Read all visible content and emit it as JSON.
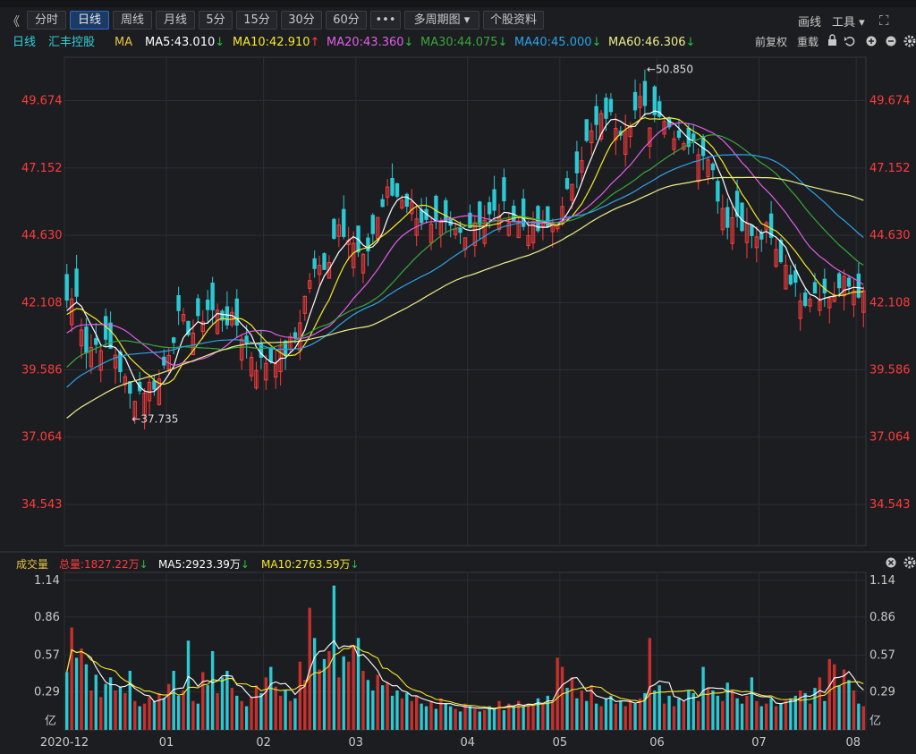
{
  "toolbar": {
    "collapse_icon": "double-chevron-left-icon",
    "collapse_glyph": "《",
    "buttons": [
      "分时",
      "日线",
      "周线",
      "月线",
      "5分",
      "15分",
      "30分",
      "60分",
      "•••",
      "多周期图 ▾",
      "个股资料"
    ],
    "active_index": 1,
    "draw_label": "画线",
    "tools_label": "工具 ▾",
    "fullscreen_icon": "fullscreen-icon",
    "fullscreen_glyph": "⛶"
  },
  "ma_legend": {
    "period": "日线",
    "stock_name": "汇丰控股",
    "indicator": "MA",
    "items": [
      {
        "text": "MA5:43.010",
        "arrow": "↓",
        "color": "#ffffff",
        "arrow_color": "#27c03c"
      },
      {
        "text": "MA10:42.910",
        "arrow": "↑",
        "color": "#f5e82a",
        "arrow_color": "#ff3b3b"
      },
      {
        "text": "MA20:43.360",
        "arrow": "↓",
        "color": "#e15fe6",
        "arrow_color": "#27c03c"
      },
      {
        "text": "MA30:44.075",
        "arrow": "↓",
        "color": "#3aa53a",
        "arrow_color": "#27c03c"
      },
      {
        "text": "MA40:45.000",
        "arrow": "↓",
        "color": "#2ba3e8",
        "arrow_color": "#27c03c"
      },
      {
        "text": "MA60:46.306",
        "arrow": "↓",
        "color": "#eded8a",
        "arrow_color": "#27c03c"
      }
    ],
    "adjust_label": "前复权",
    "reload_label": "重载",
    "lock_icon": "lock-icon",
    "undo_icon": "undo-icon",
    "zoom_in_icon": "zoom-in-icon",
    "zoom_out_icon": "zoom-out-icon",
    "settings_icon": "gear-icon"
  },
  "vol_legend": {
    "title": "成交量",
    "total": "总量:1827.22万",
    "total_arrow": "↓",
    "ma5": "MA5:2923.39万",
    "ma5_arrow": "↓",
    "ma10": "MA10:2763.59万",
    "ma10_arrow": "↓",
    "close_icon": "close-circle-icon",
    "settings_icon": "gear-icon"
  },
  "colors": {
    "up": "#ff3b3b",
    "down": "#2bc9d4",
    "grid": "#2c2e34",
    "axis_text": "#ff3b3b",
    "date_text": "#c8c8c8"
  },
  "chart_data": {
    "type": "candlestick",
    "price_ticks": [
      49.674,
      47.152,
      44.63,
      42.108,
      39.586,
      37.064,
      34.543
    ],
    "price_range": [
      33.0,
      51.3
    ],
    "x_labels": [
      "2020-12",
      "01",
      "02",
      "03",
      "04",
      "05",
      "06",
      "07",
      "08"
    ],
    "x_label_index": [
      0,
      21,
      41,
      60,
      83,
      102,
      122,
      143,
      163
    ],
    "annotations": [
      {
        "text": "←50.850",
        "index": 119,
        "price": 50.85
      },
      {
        "text": "←37.735",
        "index": 13,
        "price": 37.735
      }
    ],
    "anchors": [
      [
        0,
        42.2
      ],
      [
        2,
        42.3
      ],
      [
        4,
        40.4
      ],
      [
        7,
        40.6
      ],
      [
        10,
        40.2
      ],
      [
        13,
        38.6
      ],
      [
        16,
        38.9
      ],
      [
        19,
        39.2
      ],
      [
        23,
        41.5
      ],
      [
        26,
        41.0
      ],
      [
        29,
        41.9
      ],
      [
        32,
        41.6
      ],
      [
        35,
        41.3
      ],
      [
        39,
        39.8
      ],
      [
        42,
        40.0
      ],
      [
        45,
        40.3
      ],
      [
        47,
        40.8
      ],
      [
        50,
        43.0
      ],
      [
        54,
        43.8
      ],
      [
        56,
        45.3
      ],
      [
        58,
        44.5
      ],
      [
        61,
        43.6
      ],
      [
        64,
        45.3
      ],
      [
        66,
        46.2
      ],
      [
        69,
        46.1
      ],
      [
        72,
        45.5
      ],
      [
        75,
        44.8
      ],
      [
        78,
        44.9
      ],
      [
        81,
        44.7
      ],
      [
        84,
        45.2
      ],
      [
        87,
        45.3
      ],
      [
        90,
        45.6
      ],
      [
        93,
        45.1
      ],
      [
        96,
        44.8
      ],
      [
        99,
        44.9
      ],
      [
        102,
        45.5
      ],
      [
        105,
        47.3
      ],
      [
        108,
        48.4
      ],
      [
        111,
        49.2
      ],
      [
        114,
        48.7
      ],
      [
        116,
        49.0
      ],
      [
        118,
        49.6
      ],
      [
        120,
        48.9
      ],
      [
        122,
        49.4
      ],
      [
        124,
        48.7
      ],
      [
        126,
        48.4
      ],
      [
        128,
        48.1
      ],
      [
        130,
        47.9
      ],
      [
        132,
        47.8
      ],
      [
        134,
        46.2
      ],
      [
        136,
        45.2
      ],
      [
        138,
        45.4
      ],
      [
        140,
        44.9
      ],
      [
        142,
        44.4
      ],
      [
        144,
        44.8
      ],
      [
        146,
        44.0
      ],
      [
        148,
        43.6
      ],
      [
        150,
        42.6
      ],
      [
        152,
        42.3
      ],
      [
        154,
        42.6
      ],
      [
        157,
        42.3
      ],
      [
        160,
        42.8
      ],
      [
        162,
        42.6
      ],
      [
        164,
        42.55
      ]
    ],
    "volume_ticks": [
      1.14,
      0.86,
      0.57,
      0.29
    ],
    "volume_unit": "亿",
    "volume_range": [
      0,
      1.2
    ],
    "volume_series": [
      0.44,
      0.78,
      0.55,
      0.62,
      0.5,
      0.3,
      0.42,
      0.25,
      0.35,
      0.4,
      0.3,
      0.33,
      0.28,
      0.45,
      0.22,
      0.18,
      0.2,
      0.25,
      0.22,
      0.28,
      0.24,
      0.35,
      0.45,
      0.26,
      0.3,
      0.68,
      0.22,
      0.2,
      0.44,
      0.34,
      0.6,
      0.28,
      0.4,
      0.45,
      0.32,
      0.26,
      0.22,
      0.18,
      0.25,
      0.34,
      0.28,
      0.4,
      0.48,
      0.33,
      0.26,
      0.3,
      0.22,
      0.24,
      0.52,
      0.38,
      0.93,
      0.7,
      0.46,
      0.54,
      0.6,
      1.1,
      0.4,
      0.56,
      0.52,
      0.64,
      0.7,
      0.45,
      0.38,
      0.3,
      0.42,
      0.34,
      0.36,
      0.26,
      0.3,
      0.24,
      0.28,
      0.22,
      0.26,
      0.2,
      0.18,
      0.22,
      0.16,
      0.24,
      0.2,
      0.18,
      0.16,
      0.14,
      0.2,
      0.18,
      0.16,
      0.14,
      0.15,
      0.18,
      0.16,
      0.22,
      0.15,
      0.2,
      0.18,
      0.22,
      0.18,
      0.2,
      0.19,
      0.24,
      0.2,
      0.26,
      0.22,
      0.55,
      0.48,
      0.32,
      0.4,
      0.24,
      0.3,
      0.22,
      0.34,
      0.2,
      0.18,
      0.24,
      0.26,
      0.2,
      0.22,
      0.18,
      0.22,
      0.2,
      0.24,
      0.28,
      0.7,
      0.3,
      0.34,
      0.2,
      0.26,
      0.18,
      0.24,
      0.22,
      0.3,
      0.28,
      0.22,
      0.48,
      0.32,
      0.3,
      0.26,
      0.22,
      0.36,
      0.3,
      0.24,
      0.2,
      0.26,
      0.4,
      0.22,
      0.18,
      0.2,
      0.24,
      0.18,
      0.2,
      0.22,
      0.24,
      0.26,
      0.3,
      0.28,
      0.2,
      0.32,
      0.4,
      0.22,
      0.54,
      0.5,
      0.34,
      0.46,
      0.38,
      0.3,
      0.2,
      0.18
    ],
    "volume_up_flags": [
      0,
      1,
      0,
      1,
      0,
      1,
      0,
      1,
      0,
      0,
      1,
      0,
      1,
      0,
      1,
      0,
      1,
      1,
      0,
      1,
      0,
      1,
      0,
      0,
      1,
      0,
      1,
      0,
      1,
      0,
      0,
      1,
      0,
      0,
      1,
      0,
      1,
      0,
      1,
      1,
      0,
      1,
      0,
      1,
      1,
      0,
      1,
      0,
      1,
      1,
      1,
      0,
      1,
      0,
      1,
      0,
      1,
      0,
      1,
      1,
      0,
      1,
      0,
      0,
      1,
      0,
      1,
      0,
      0,
      1,
      0,
      1,
      1,
      0,
      0,
      1,
      0,
      1,
      0,
      0,
      1,
      0,
      1,
      0,
      1,
      0,
      1,
      0,
      0,
      1,
      0,
      1,
      0,
      1,
      0,
      1,
      1,
      0,
      1,
      0,
      1,
      1,
      1,
      0,
      1,
      0,
      1,
      0,
      1,
      0,
      1,
      0,
      0,
      1,
      0,
      1,
      1,
      0,
      1,
      0,
      1,
      0,
      0,
      1,
      0,
      1,
      0,
      1,
      0,
      0,
      1,
      0,
      1,
      0,
      0,
      1,
      0,
      1,
      0,
      0,
      1,
      0,
      1,
      0,
      1,
      0,
      1,
      0,
      1,
      0,
      0,
      1,
      0,
      1,
      0,
      1,
      0,
      1,
      1,
      0,
      1,
      0,
      1,
      0,
      1
    ],
    "series_names": [
      "MA5",
      "MA10",
      "MA20",
      "MA30",
      "MA40",
      "MA60"
    ]
  }
}
